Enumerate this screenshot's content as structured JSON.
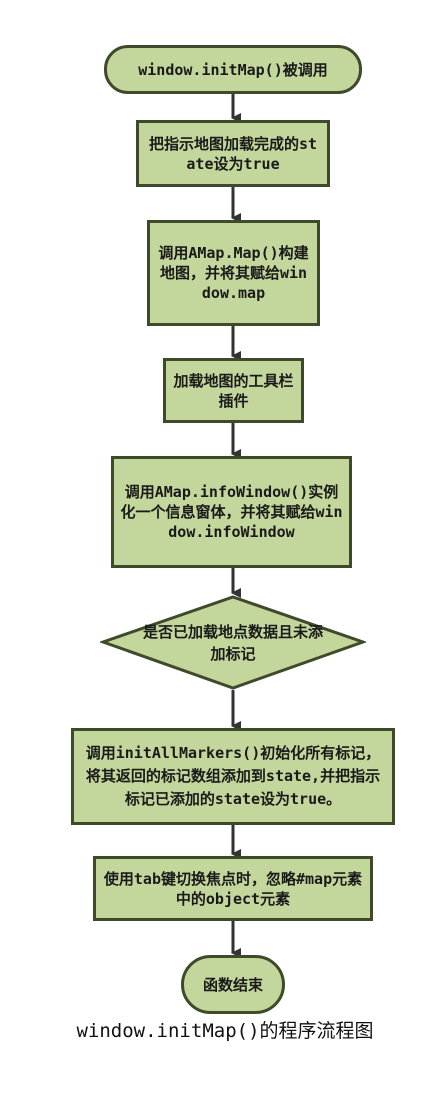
{
  "flowchart": {
    "start": "window.initMap()被调用",
    "step1": "把指示地图加载完成的state设为true",
    "step2": "调用AMap.Map()构建地图，并将其赋给window.map",
    "step3": "加载地图的工具栏插件",
    "step4": "调用AMap.infoWindow()实例化一个信息窗体，并将其赋给window.infoWindow",
    "decision": "是否已加载地点数据且未添加标记",
    "step5": "调用initAllMarkers()初始化所有标记，将其返回的标记数组添加到state,并把指示标记已添加的state设为true。",
    "step6": "使用tab键切换焦点时，忽略#map元素中的object元素",
    "end": "函数结束"
  },
  "caption": "window.initMap()的程序流程图",
  "colors": {
    "fill": "#c3d69b",
    "border": "#3f4a2b",
    "arrow": "#333333"
  }
}
